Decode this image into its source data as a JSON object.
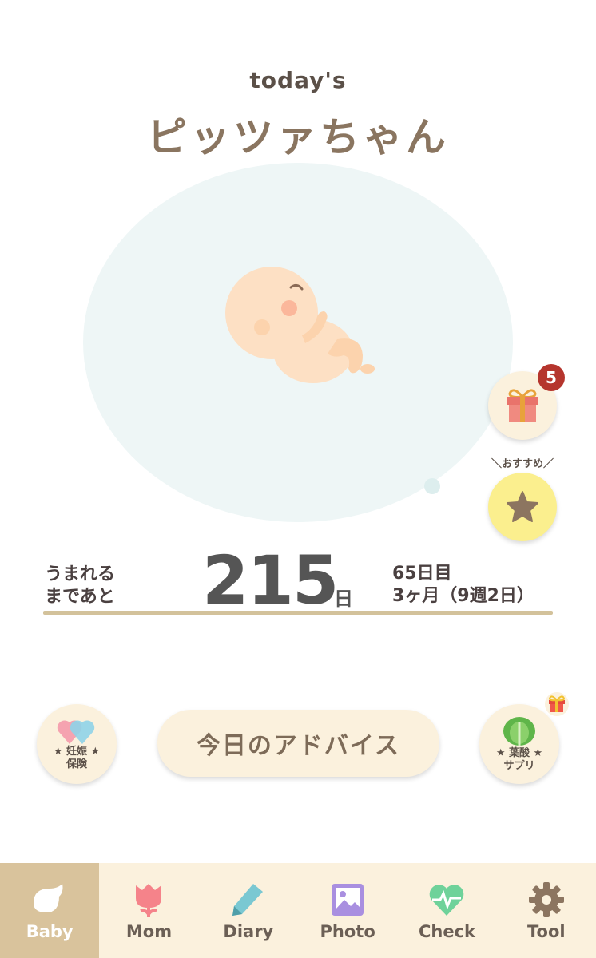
{
  "header": {
    "today_label": "today's",
    "baby_name": "ピッツァちゃん"
  },
  "gift": {
    "badge_count": "5",
    "icon": "gift-icon"
  },
  "recommend": {
    "caption": "＼おすすめ／",
    "icon": "star-icon"
  },
  "countdown": {
    "label_line1": "うまれる",
    "label_line2": "まであと",
    "days": "215",
    "unit": "日",
    "day_of_pregnancy": "65日目",
    "month_week": "3ヶ月（9週2日）"
  },
  "actions": {
    "insurance_line1": "★ 妊娠 ★",
    "insurance_line2": "保険",
    "advice_label": "今日のアドバイス",
    "supplement_line1": "★ 葉酸 ★",
    "supplement_line2": "サプリ"
  },
  "nav": {
    "items": [
      {
        "label": "Baby",
        "icon": "bird-icon",
        "active": true
      },
      {
        "label": "Mom",
        "icon": "tulip-icon",
        "active": false
      },
      {
        "label": "Diary",
        "icon": "pencil-icon",
        "active": false
      },
      {
        "label": "Photo",
        "icon": "photo-icon",
        "active": false
      },
      {
        "label": "Check",
        "icon": "heartbeat-icon",
        "active": false
      },
      {
        "label": "Tool",
        "icon": "gear-icon",
        "active": false
      }
    ]
  },
  "colors": {
    "accent": "#d9c39c",
    "nav_bg": "#fbf1dd",
    "badge": "#b5352d",
    "bubble": "#eef6f6"
  }
}
